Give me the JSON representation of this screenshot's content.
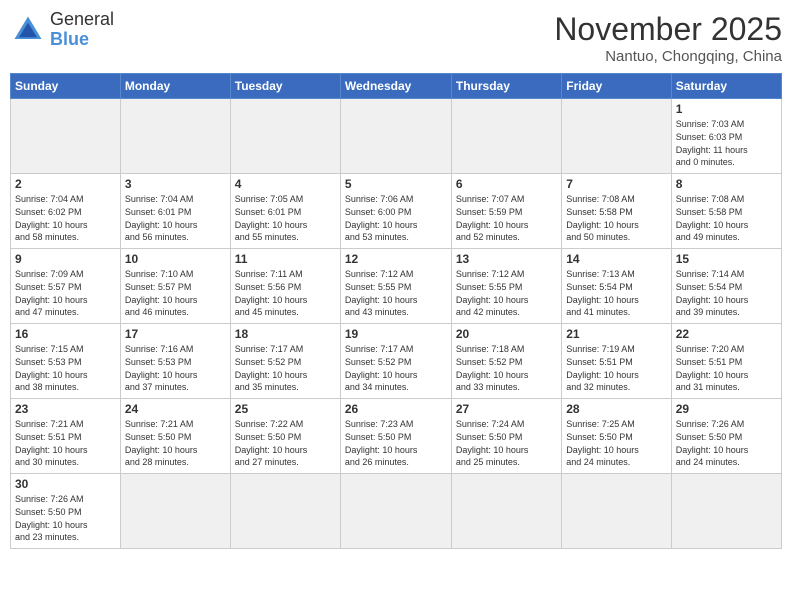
{
  "header": {
    "logo_text_general": "General",
    "logo_text_blue": "Blue",
    "month_title": "November 2025",
    "location": "Nantuo, Chongqing, China"
  },
  "days_of_week": [
    "Sunday",
    "Monday",
    "Tuesday",
    "Wednesday",
    "Thursday",
    "Friday",
    "Saturday"
  ],
  "weeks": [
    [
      {
        "day": "",
        "info": ""
      },
      {
        "day": "",
        "info": ""
      },
      {
        "day": "",
        "info": ""
      },
      {
        "day": "",
        "info": ""
      },
      {
        "day": "",
        "info": ""
      },
      {
        "day": "",
        "info": ""
      },
      {
        "day": "1",
        "info": "Sunrise: 7:03 AM\nSunset: 6:03 PM\nDaylight: 11 hours\nand 0 minutes."
      }
    ],
    [
      {
        "day": "2",
        "info": "Sunrise: 7:04 AM\nSunset: 6:02 PM\nDaylight: 10 hours\nand 58 minutes."
      },
      {
        "day": "3",
        "info": "Sunrise: 7:04 AM\nSunset: 6:01 PM\nDaylight: 10 hours\nand 56 minutes."
      },
      {
        "day": "4",
        "info": "Sunrise: 7:05 AM\nSunset: 6:01 PM\nDaylight: 10 hours\nand 55 minutes."
      },
      {
        "day": "5",
        "info": "Sunrise: 7:06 AM\nSunset: 6:00 PM\nDaylight: 10 hours\nand 53 minutes."
      },
      {
        "day": "6",
        "info": "Sunrise: 7:07 AM\nSunset: 5:59 PM\nDaylight: 10 hours\nand 52 minutes."
      },
      {
        "day": "7",
        "info": "Sunrise: 7:08 AM\nSunset: 5:58 PM\nDaylight: 10 hours\nand 50 minutes."
      },
      {
        "day": "8",
        "info": "Sunrise: 7:08 AM\nSunset: 5:58 PM\nDaylight: 10 hours\nand 49 minutes."
      }
    ],
    [
      {
        "day": "9",
        "info": "Sunrise: 7:09 AM\nSunset: 5:57 PM\nDaylight: 10 hours\nand 47 minutes."
      },
      {
        "day": "10",
        "info": "Sunrise: 7:10 AM\nSunset: 5:57 PM\nDaylight: 10 hours\nand 46 minutes."
      },
      {
        "day": "11",
        "info": "Sunrise: 7:11 AM\nSunset: 5:56 PM\nDaylight: 10 hours\nand 45 minutes."
      },
      {
        "day": "12",
        "info": "Sunrise: 7:12 AM\nSunset: 5:55 PM\nDaylight: 10 hours\nand 43 minutes."
      },
      {
        "day": "13",
        "info": "Sunrise: 7:12 AM\nSunset: 5:55 PM\nDaylight: 10 hours\nand 42 minutes."
      },
      {
        "day": "14",
        "info": "Sunrise: 7:13 AM\nSunset: 5:54 PM\nDaylight: 10 hours\nand 41 minutes."
      },
      {
        "day": "15",
        "info": "Sunrise: 7:14 AM\nSunset: 5:54 PM\nDaylight: 10 hours\nand 39 minutes."
      }
    ],
    [
      {
        "day": "16",
        "info": "Sunrise: 7:15 AM\nSunset: 5:53 PM\nDaylight: 10 hours\nand 38 minutes."
      },
      {
        "day": "17",
        "info": "Sunrise: 7:16 AM\nSunset: 5:53 PM\nDaylight: 10 hours\nand 37 minutes."
      },
      {
        "day": "18",
        "info": "Sunrise: 7:17 AM\nSunset: 5:52 PM\nDaylight: 10 hours\nand 35 minutes."
      },
      {
        "day": "19",
        "info": "Sunrise: 7:17 AM\nSunset: 5:52 PM\nDaylight: 10 hours\nand 34 minutes."
      },
      {
        "day": "20",
        "info": "Sunrise: 7:18 AM\nSunset: 5:52 PM\nDaylight: 10 hours\nand 33 minutes."
      },
      {
        "day": "21",
        "info": "Sunrise: 7:19 AM\nSunset: 5:51 PM\nDaylight: 10 hours\nand 32 minutes."
      },
      {
        "day": "22",
        "info": "Sunrise: 7:20 AM\nSunset: 5:51 PM\nDaylight: 10 hours\nand 31 minutes."
      }
    ],
    [
      {
        "day": "23",
        "info": "Sunrise: 7:21 AM\nSunset: 5:51 PM\nDaylight: 10 hours\nand 30 minutes."
      },
      {
        "day": "24",
        "info": "Sunrise: 7:21 AM\nSunset: 5:50 PM\nDaylight: 10 hours\nand 28 minutes."
      },
      {
        "day": "25",
        "info": "Sunrise: 7:22 AM\nSunset: 5:50 PM\nDaylight: 10 hours\nand 27 minutes."
      },
      {
        "day": "26",
        "info": "Sunrise: 7:23 AM\nSunset: 5:50 PM\nDaylight: 10 hours\nand 26 minutes."
      },
      {
        "day": "27",
        "info": "Sunrise: 7:24 AM\nSunset: 5:50 PM\nDaylight: 10 hours\nand 25 minutes."
      },
      {
        "day": "28",
        "info": "Sunrise: 7:25 AM\nSunset: 5:50 PM\nDaylight: 10 hours\nand 24 minutes."
      },
      {
        "day": "29",
        "info": "Sunrise: 7:26 AM\nSunset: 5:50 PM\nDaylight: 10 hours\nand 24 minutes."
      }
    ],
    [
      {
        "day": "30",
        "info": "Sunrise: 7:26 AM\nSunset: 5:50 PM\nDaylight: 10 hours\nand 23 minutes."
      },
      {
        "day": "",
        "info": ""
      },
      {
        "day": "",
        "info": ""
      },
      {
        "day": "",
        "info": ""
      },
      {
        "day": "",
        "info": ""
      },
      {
        "day": "",
        "info": ""
      },
      {
        "day": "",
        "info": ""
      }
    ]
  ]
}
